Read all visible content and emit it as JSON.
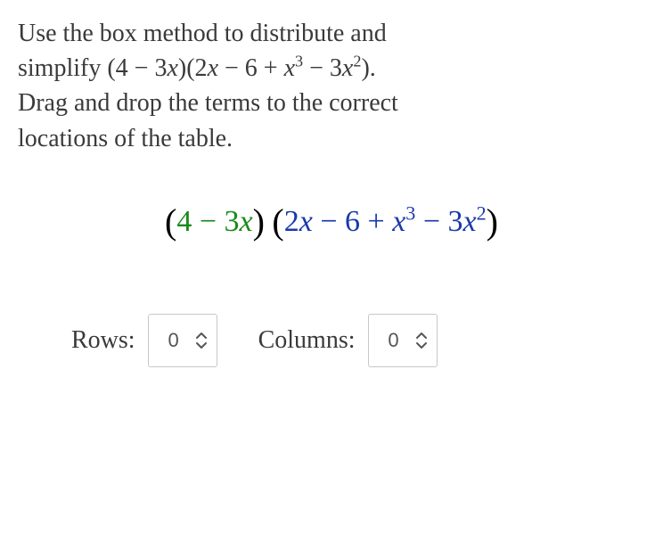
{
  "instructions": {
    "line1": "Use the box method to distribute and",
    "line2_pre": "simplify ",
    "line2_expr": "(4 − 3x)(2x − 6 + x³ − 3x²).",
    "line3": "Drag and drop the terms to the correct",
    "line4": "locations of the table."
  },
  "expression": {
    "factor1": "4 − 3x",
    "factor2": "2x − 6 + x³ − 3x²",
    "lparen": "(",
    "rparen": ")"
  },
  "controls": {
    "rows_label": "Rows:",
    "rows_value": "0",
    "columns_label": "Columns:",
    "columns_value": "0"
  }
}
